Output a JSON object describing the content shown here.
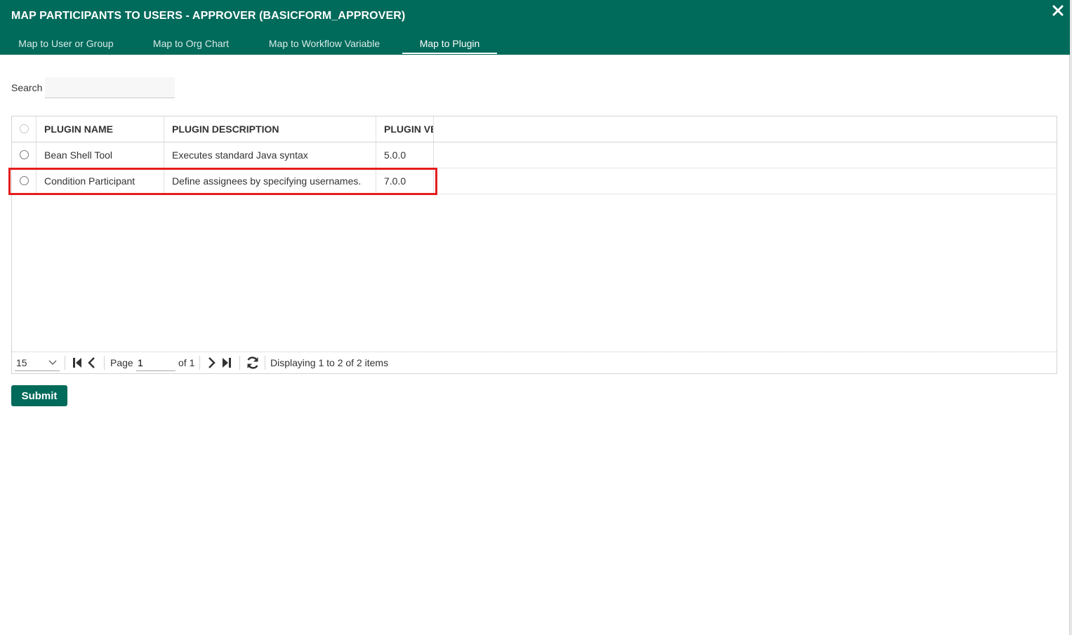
{
  "dialog": {
    "title": "MAP PARTICIPANTS TO USERS - APPROVER (BASICFORM_APPROVER)",
    "close_icon": "close-icon"
  },
  "tabs": [
    {
      "label": "Map to User or Group",
      "active": false
    },
    {
      "label": "Map to Org Chart",
      "active": false
    },
    {
      "label": "Map to Workflow Variable",
      "active": false
    },
    {
      "label": "Map to Plugin",
      "active": true
    }
  ],
  "search": {
    "label": "Search",
    "value": "",
    "placeholder": ""
  },
  "grid": {
    "columns": [
      "PLUGIN NAME",
      "PLUGIN DESCRIPTION",
      "PLUGIN VE"
    ],
    "rows": [
      {
        "name": "Bean Shell Tool",
        "description": "Executes standard Java syntax",
        "version": "5.0.0",
        "selected": false
      },
      {
        "name": "Condition Participant",
        "description": "Define assignees by specifying usernames.",
        "version": "7.0.0",
        "selected": false,
        "highlighted": true
      }
    ]
  },
  "pager": {
    "page_size": "15",
    "page_label": "Page",
    "current_page": "1",
    "total_pages_label": "of 1",
    "status": "Displaying 1 to 2 of 2 items"
  },
  "actions": {
    "submit_label": "Submit"
  },
  "colors": {
    "brand": "#006a5b",
    "highlight": "#e41d1d"
  }
}
